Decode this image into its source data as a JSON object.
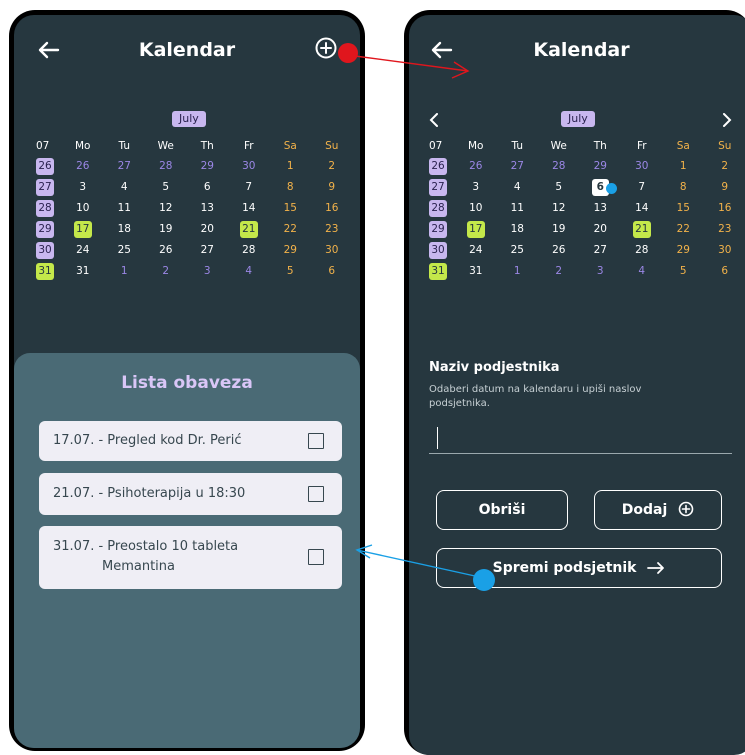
{
  "app": {
    "title": "Kalendar"
  },
  "calendar": {
    "month": "July",
    "week_header": "07",
    "day_headers": [
      "Mo",
      "Tu",
      "We",
      "Th",
      "Fr",
      "Sa",
      "Su"
    ],
    "weeks": [
      {
        "week": "26",
        "days": [
          "26",
          "27",
          "28",
          "29",
          "30",
          "1",
          "2"
        ]
      },
      {
        "week": "27",
        "days": [
          "3",
          "4",
          "5",
          "6",
          "7",
          "8",
          "9"
        ]
      },
      {
        "week": "28",
        "days": [
          "10",
          "11",
          "12",
          "13",
          "14",
          "15",
          "16"
        ]
      },
      {
        "week": "29",
        "days": [
          "17",
          "18",
          "19",
          "20",
          "21",
          "22",
          "23"
        ]
      },
      {
        "week": "30",
        "days": [
          "24",
          "25",
          "26",
          "27",
          "28",
          "29",
          "30"
        ]
      },
      {
        "week": "31",
        "days": [
          "31",
          "1",
          "2",
          "3",
          "4",
          "5",
          "6"
        ]
      }
    ],
    "selected_day": "6",
    "highlighted_days": [
      "17",
      "21"
    ]
  },
  "task_list": {
    "title": "Lista obaveza",
    "items": [
      {
        "text": "17.07. - Pregled kod Dr. Perić",
        "checked": false
      },
      {
        "text": "21.07. - Psihoterapija u 18:30",
        "checked": false
      },
      {
        "text_line1": "31.07. - Preostalo 10 tableta",
        "text_line2": "Memantina",
        "checked": false
      }
    ]
  },
  "reminder_form": {
    "label": "Naziv podjestnika",
    "help": "Odaberi datum na kalendaru i upiši naslov podsjetnika.",
    "input_value": "",
    "delete_label": "Obriši",
    "add_label": "Dodaj",
    "save_label": "Spremi podsjetnik"
  },
  "icons": {
    "back": "back-arrow-icon",
    "add": "plus-circle-icon",
    "prev_month": "chevron-left-icon",
    "next_month": "chevron-right-icon",
    "save_arrow": "arrow-right-icon"
  },
  "colors": {
    "screen_bg": "#26373f",
    "panel_bg": "#4a6a75",
    "accent_purple": "#c8b7ef",
    "accent_green": "#c4e84a",
    "weekend": "#f2b24a",
    "annotation_red": "#e0161d",
    "annotation_blue": "#1aa0e6"
  }
}
